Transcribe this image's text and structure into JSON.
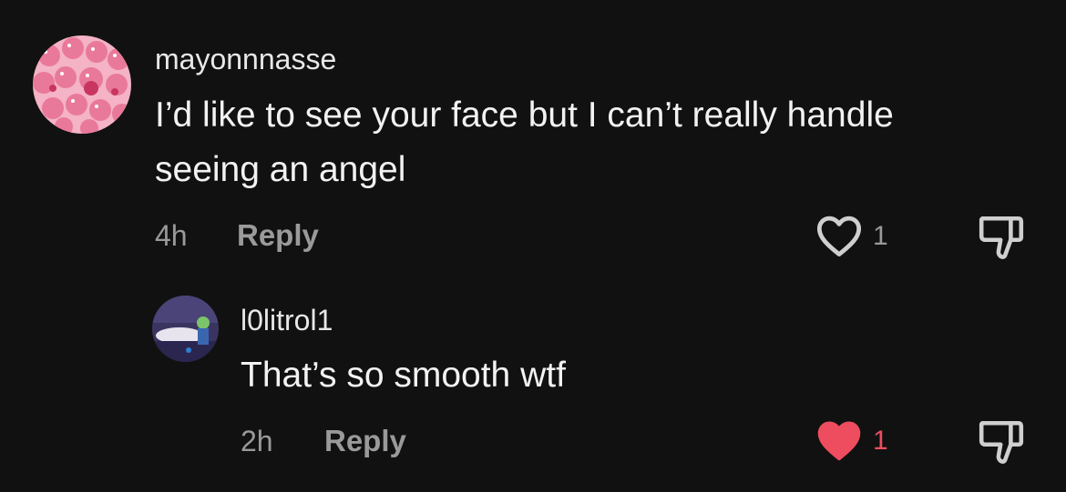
{
  "comments": [
    {
      "username": "mayonnnasse",
      "text": "I’d like to see your face but I can’t really handle seeing an angel",
      "time": "4h",
      "reply_label": "Reply",
      "like_count": "1",
      "liked": false
    },
    {
      "username": "l0litrol1",
      "text": "That’s so smooth wtf",
      "time": "2h",
      "reply_label": "Reply",
      "like_count": "1",
      "liked": true
    }
  ],
  "colors": {
    "background": "#111111",
    "liked": "#ee4d5f",
    "muted": "#9a9a9a"
  },
  "icons": {
    "like": "heart-icon",
    "dislike": "thumbs-down-icon"
  }
}
